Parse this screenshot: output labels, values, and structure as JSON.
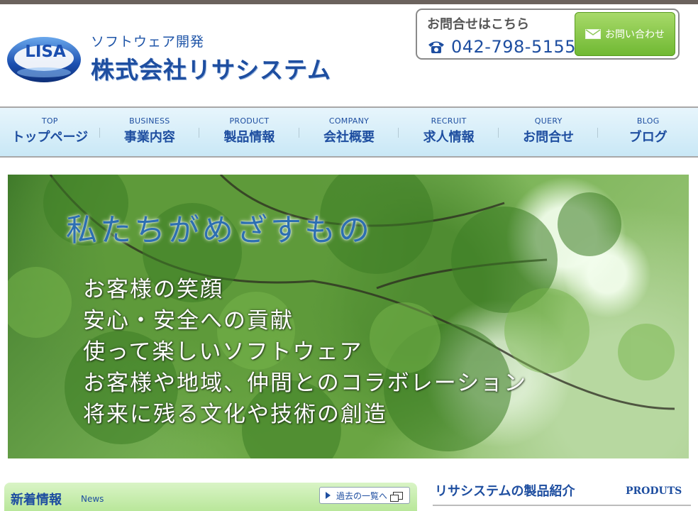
{
  "header": {
    "logo_text": "LISA",
    "tagline": "ソフトウェア開発",
    "company_name": "株式会社リサシステム",
    "contact": {
      "title": "お問合せはこちら",
      "phone": "042-798-5155",
      "mail_button": "お問い合わせ"
    }
  },
  "nav": {
    "items": [
      {
        "en": "TOP",
        "jp": "トップページ"
      },
      {
        "en": "BUSINESS",
        "jp": "事業内容"
      },
      {
        "en": "PRODUCT",
        "jp": "製品情報"
      },
      {
        "en": "COMPANY",
        "jp": "会社概要"
      },
      {
        "en": "RECRUIT",
        "jp": "求人情報"
      },
      {
        "en": "QUERY",
        "jp": "お問合せ"
      },
      {
        "en": "BLOG",
        "jp": "ブログ"
      }
    ]
  },
  "hero": {
    "title": "私たちがめざすもの",
    "lines": [
      "お客様の笑顔",
      "安心・安全への貢献",
      "使って楽しいソフトウェア",
      "お客様や地域、仲間とのコラボレーション",
      "将来に残る文化や技術の創造"
    ]
  },
  "news": {
    "title": "新着情報",
    "subtitle": "News",
    "archive_button": "過去の一覧へ"
  },
  "products": {
    "title": "リサシステムの製品紹介",
    "subtitle": "PRODUTS"
  },
  "colors": {
    "brand_blue": "#1e4ea0",
    "nav_bg": "#c9e8f6",
    "mail_green": "#6fb832"
  }
}
